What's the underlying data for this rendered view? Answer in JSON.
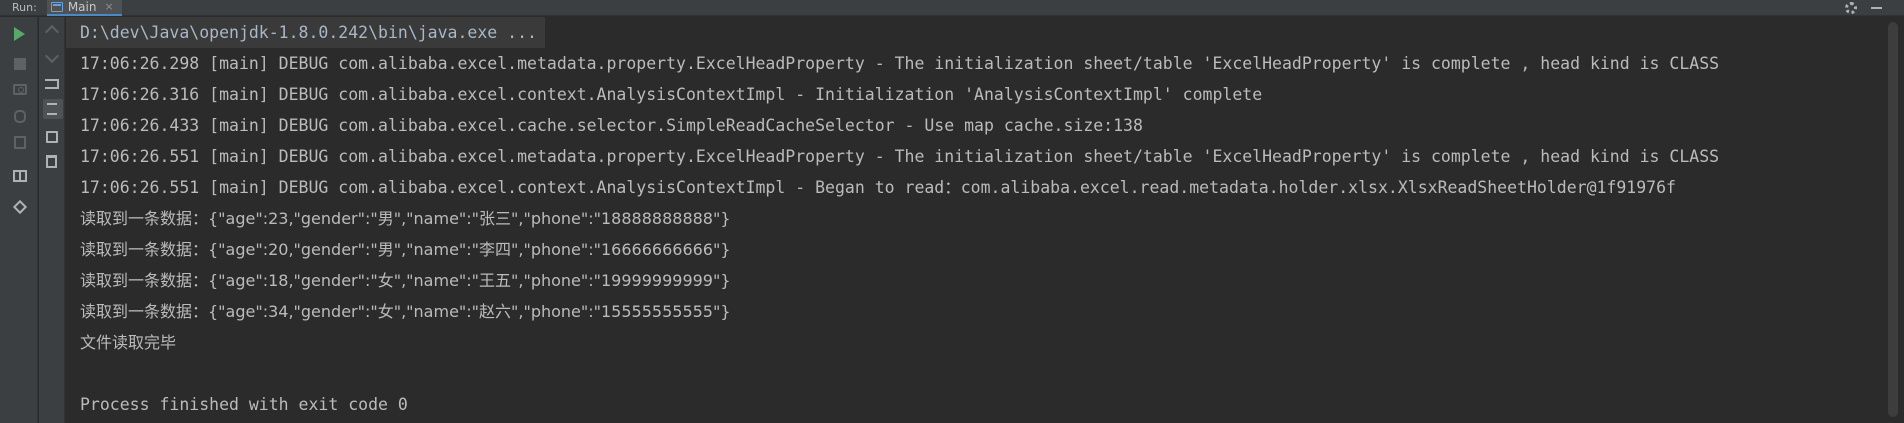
{
  "header": {
    "run_label": "Run:",
    "tab_label": "Main"
  },
  "console": {
    "lines": [
      "D:\\dev\\Java\\openjdk-1.8.0.242\\bin\\java.exe ...",
      "17:06:26.298 [main] DEBUG com.alibaba.excel.metadata.property.ExcelHeadProperty - The initialization sheet/table 'ExcelHeadProperty' is complete , head kind is CLASS",
      "17:06:26.316 [main] DEBUG com.alibaba.excel.context.AnalysisContextImpl - Initialization 'AnalysisContextImpl' complete",
      "17:06:26.433 [main] DEBUG com.alibaba.excel.cache.selector.SimpleReadCacheSelector - Use map cache.size:138",
      "17:06:26.551 [main] DEBUG com.alibaba.excel.metadata.property.ExcelHeadProperty - The initialization sheet/table 'ExcelHeadProperty' is complete , head kind is CLASS",
      "17:06:26.551 [main] DEBUG com.alibaba.excel.context.AnalysisContextImpl - Began to read：com.alibaba.excel.read.metadata.holder.xlsx.XlsxReadSheetHolder@1f91976f",
      "读取到一条数据：{\"age\":23,\"gender\":\"男\",\"name\":\"张三\",\"phone\":\"18888888888\"}",
      "读取到一条数据：{\"age\":20,\"gender\":\"男\",\"name\":\"李四\",\"phone\":\"16666666666\"}",
      "读取到一条数据：{\"age\":18,\"gender\":\"女\",\"name\":\"王五\",\"phone\":\"19999999999\"}",
      "读取到一条数据：{\"age\":34,\"gender\":\"女\",\"name\":\"赵六\",\"phone\":\"15555555555\"}",
      "文件读取完毕",
      "",
      "Process finished with exit code 0"
    ]
  },
  "icons": {
    "run": "play-icon",
    "stop": "stop-icon",
    "snapshot": "camera-icon",
    "debug": "bug-icon",
    "exit": "login-icon",
    "layout": "layout-icon",
    "pin": "pin-icon",
    "up": "up-arrow-icon",
    "down": "down-arrow-icon",
    "soft_wrap": "soft-wrap-icon",
    "scroll_to_end": "scroll-to-end-icon",
    "print": "printer-icon",
    "clear": "trash-icon",
    "settings": "gear-icon",
    "hide": "minimize-icon"
  },
  "colors": {
    "run_green": "#59a869",
    "tab_underline": "#4a88c7"
  }
}
